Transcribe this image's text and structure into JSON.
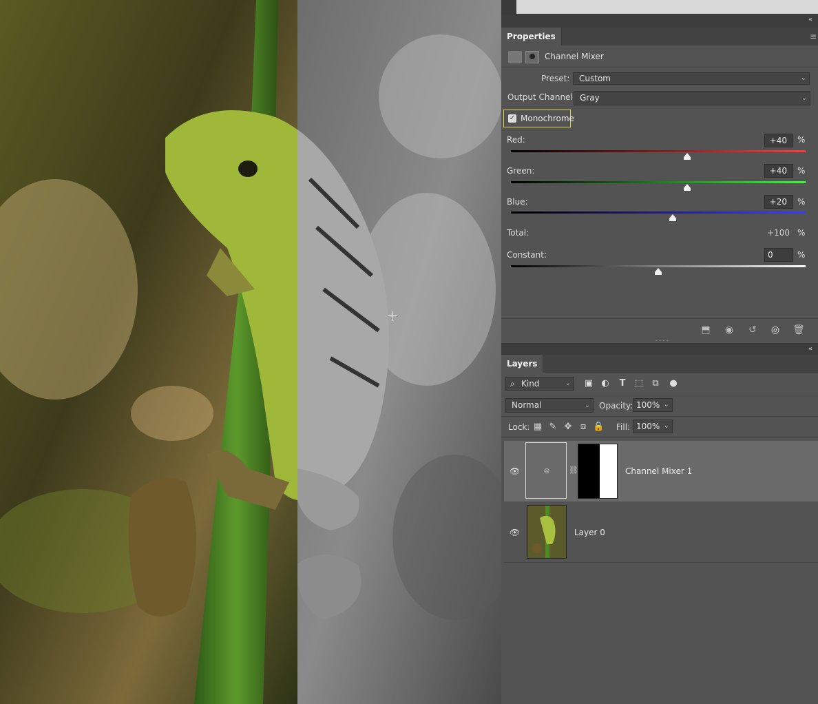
{
  "canvas": {
    "description_icon": "canvas-image"
  },
  "properties": {
    "tab_label": "Properties",
    "adjustment_name": "Channel Mixer",
    "preset_label": "Preset:",
    "preset_value": "Custom",
    "output_channel_label": "Output Channel:",
    "output_channel_value": "Gray",
    "monochrome_label": "Monochrome",
    "monochrome_checked": true,
    "red_label": "Red:",
    "red_value": "+40",
    "green_label": "Green:",
    "green_value": "+40",
    "blue_label": "Blue:",
    "blue_value": "+20",
    "total_label": "Total:",
    "total_value": "+100",
    "constant_label": "Constant:",
    "constant_value": "0",
    "percent": "%",
    "slider_levels": {
      "red": 40,
      "green": 40,
      "blue": 20,
      "constant": 0
    }
  },
  "layers": {
    "tab_label": "Layers",
    "kind_label": "Kind",
    "blend_mode": "Normal",
    "opacity_label": "Opacity:",
    "opacity_value": "100%",
    "lock_label": "Lock:",
    "fill_label": "Fill:",
    "fill_value": "100%",
    "items": [
      {
        "name": "Channel Mixer 1",
        "selected": true
      },
      {
        "name": "Layer 0",
        "selected": false
      }
    ]
  },
  "colors": {
    "highlight": "#e3d84a",
    "panel_bg": "#535353",
    "selected_layer": "#6a6a6a"
  }
}
